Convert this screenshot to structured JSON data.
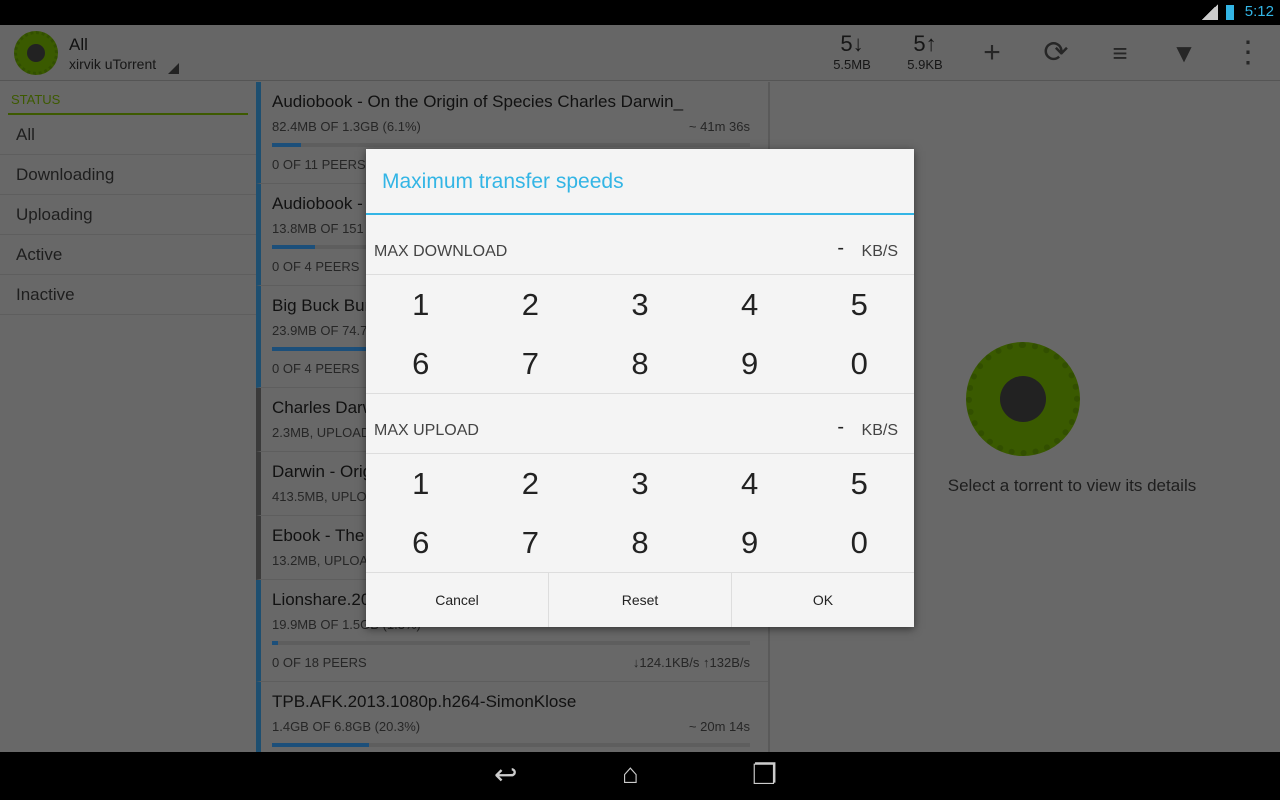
{
  "status_bar": {
    "network": "3G",
    "time": "5:12"
  },
  "action_bar": {
    "title": "All",
    "subtitle": "xirvik uTorrent",
    "download_count": "5↓",
    "download_size": "5.5MB",
    "upload_count": "5↑",
    "upload_size": "5.9KB",
    "icons": [
      "add-icon",
      "refresh-icon",
      "sort-icon",
      "filter-icon",
      "overflow-menu-icon"
    ]
  },
  "sidebar": {
    "header": "STATUS",
    "items": [
      {
        "label": "All"
      },
      {
        "label": "Downloading"
      },
      {
        "label": "Uploading"
      },
      {
        "label": "Active"
      },
      {
        "label": "Inactive"
      }
    ]
  },
  "torrents": [
    {
      "title": "Audiobook - On the Origin of Species  Charles Darwin_",
      "sub": "82.4MB OF 1.3GB (6.1%)",
      "eta": "~ 41m 36s",
      "progress": 6.1,
      "peers": "0 OF 11 PEERS",
      "speed": "",
      "state": "downloading"
    },
    {
      "title": "Audiobook - T",
      "sub": "13.8MB OF 151",
      "eta": "",
      "progress": 9.1,
      "peers": "0 OF 4 PEERS",
      "speed": "",
      "state": "downloading"
    },
    {
      "title": "Big Buck Bun",
      "sub": "23.9MB OF 74.7",
      "eta": "",
      "progress": 32,
      "peers": "0 OF 4 PEERS",
      "speed": "",
      "state": "downloading"
    },
    {
      "title": "Charles Darwi",
      "sub": "2.3MB, UPLOAD",
      "state": "seeding"
    },
    {
      "title": "Darwin - Origi",
      "sub": "413.5MB, UPLO",
      "state": "seeding"
    },
    {
      "title": "Ebook - The D",
      "sub": "13.2MB, UPLOA",
      "state": "seeding"
    },
    {
      "title": "Lionshare.200",
      "sub": "19.9MB OF 1.5GB (1.3%)",
      "eta": "",
      "progress": 1.3,
      "peers": "0 OF 18 PEERS",
      "speed": "↓124.1KB/s ↑132B/s",
      "state": "downloading"
    },
    {
      "title": "TPB.AFK.2013.1080p.h264-SimonKlose",
      "sub": "1.4GB OF 6.8GB (20.3%)",
      "eta": "~ 20m 14s",
      "progress": 20.3,
      "peers": "",
      "speed": "",
      "state": "downloading"
    }
  ],
  "detail": {
    "empty_text": "Select a torrent to view its details"
  },
  "dialog": {
    "title": "Maximum transfer speeds",
    "download": {
      "label": "MAX DOWNLOAD",
      "value": "-",
      "unit": "KB/S"
    },
    "upload": {
      "label": "MAX UPLOAD",
      "value": "-",
      "unit": "KB/S"
    },
    "keys": [
      "1",
      "2",
      "3",
      "4",
      "5",
      "6",
      "7",
      "8",
      "9",
      "0"
    ],
    "buttons": {
      "cancel": "Cancel",
      "reset": "Reset",
      "ok": "OK"
    }
  },
  "colors": {
    "accent": "#33b5e5",
    "brand_green": "#669900",
    "progress": "#1e6fb0"
  }
}
